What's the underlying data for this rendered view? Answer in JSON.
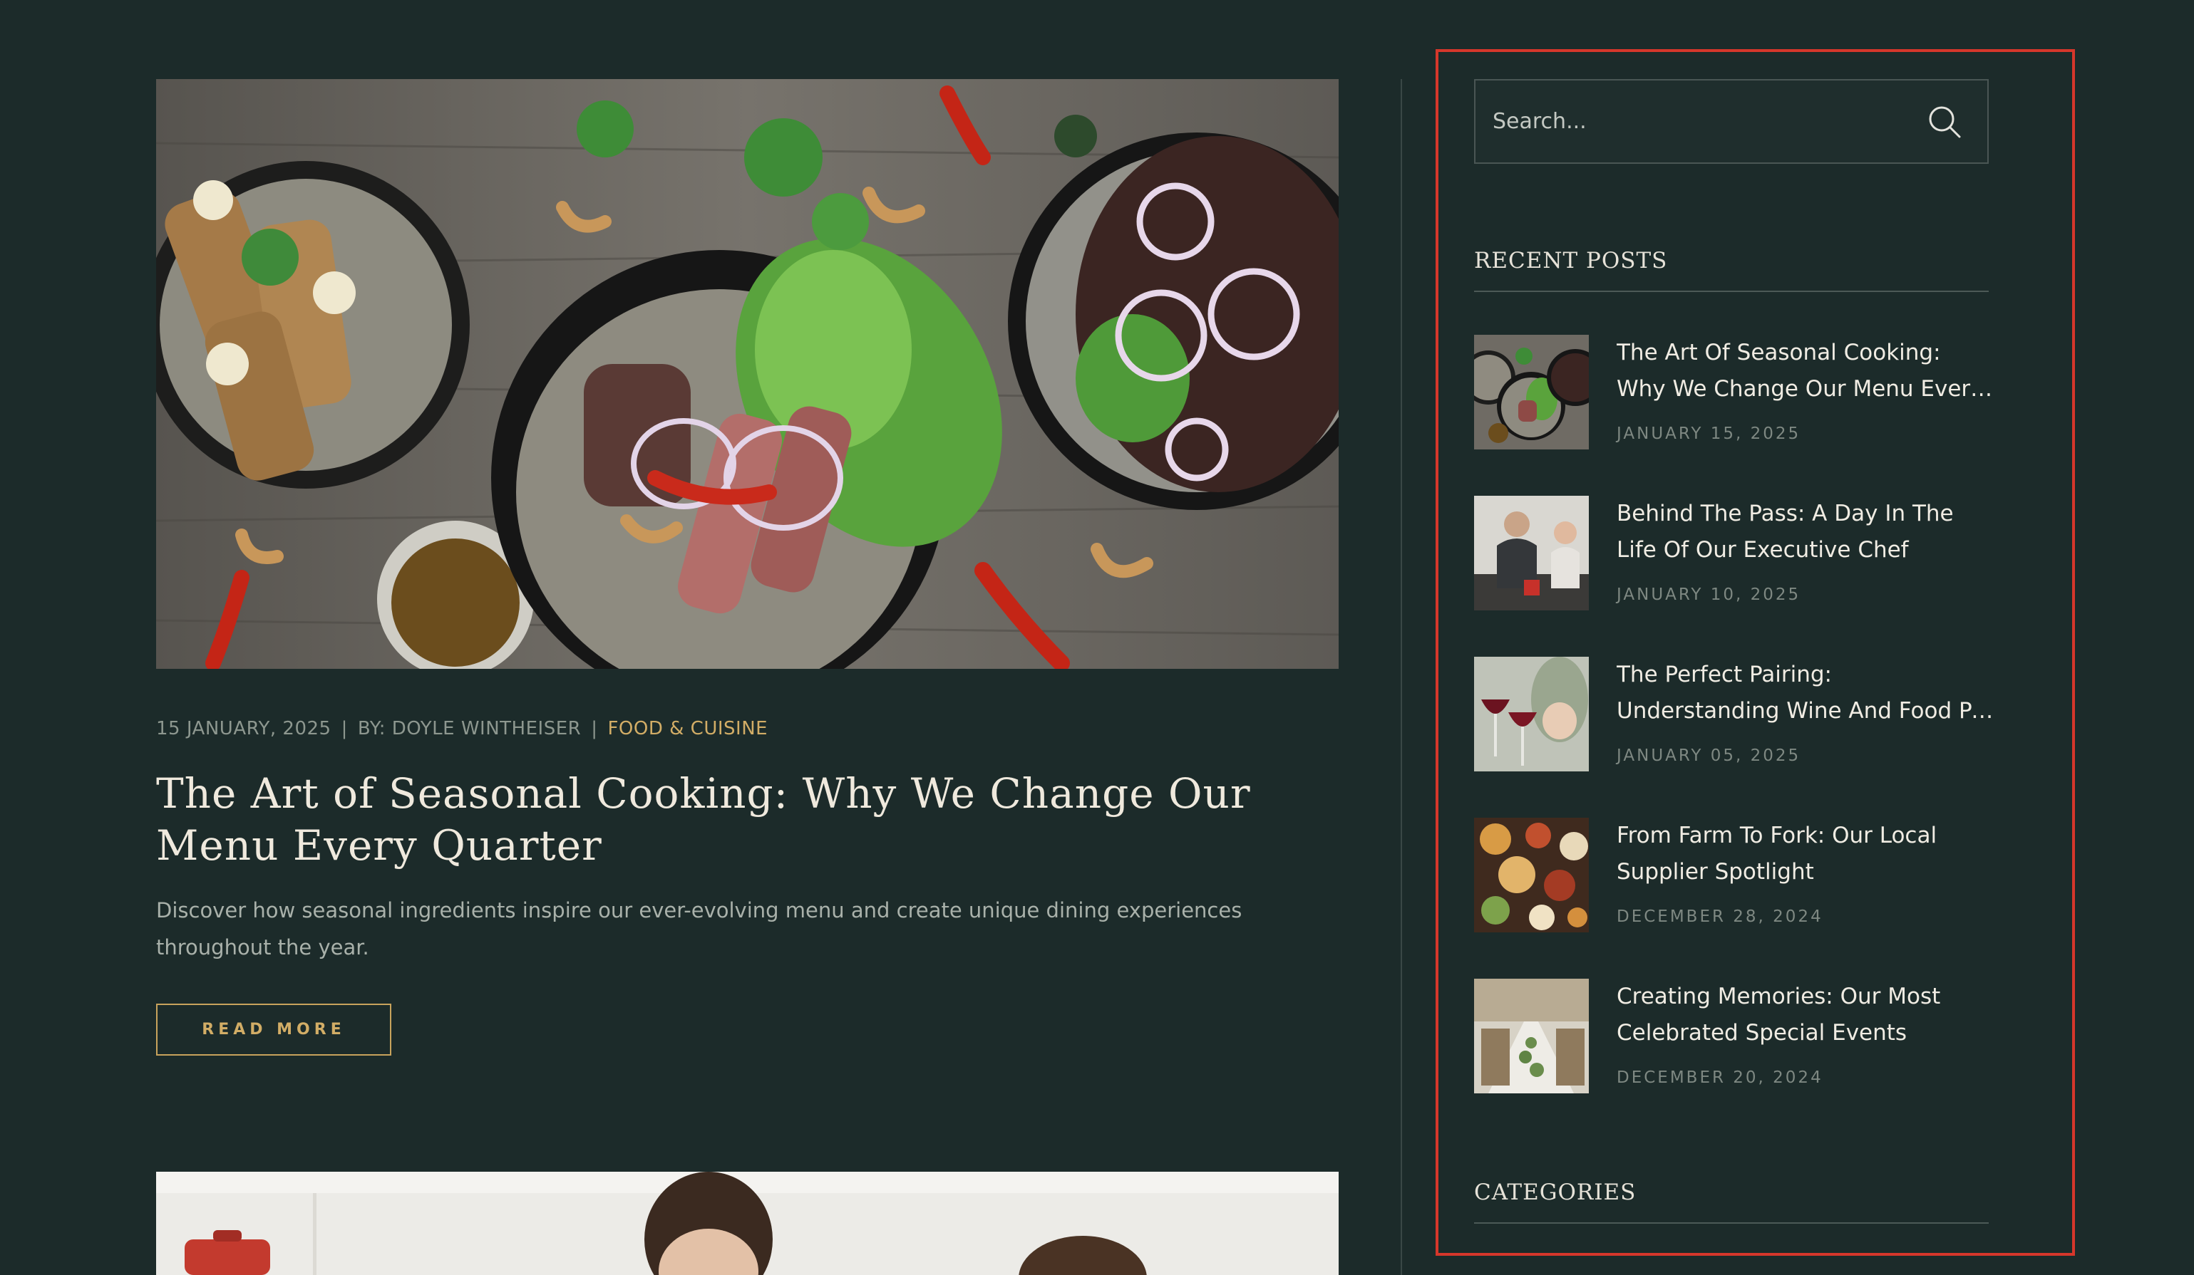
{
  "post": {
    "date": "15 JANUARY, 2025",
    "separator": "|",
    "author": "BY: DOYLE WINTHEISER",
    "category": "FOOD & CUISINE",
    "title": "The Art of Seasonal Cooking: Why We Change Our Menu Every Quarter",
    "excerpt": "Discover how seasonal ingredients inspire our ever-evolving menu and create unique dining experiences throughout the year.",
    "read_more_label": "READ MORE"
  },
  "sidebar": {
    "search": {
      "placeholder": "Search..."
    },
    "recent_posts_title": "RECENT POSTS",
    "recent_posts": [
      {
        "title_line1": "The Art Of Seasonal Cooking:",
        "title_line2": "Why We Change Our Menu Every Quarter",
        "date": "JANUARY 15, 2025"
      },
      {
        "title_line1": "Behind The Pass: A Day In The",
        "title_line2": "Life Of Our Executive Chef",
        "date": "JANUARY 10, 2025"
      },
      {
        "title_line1": "The Perfect Pairing:",
        "title_line2": "Understanding Wine And Food Pairings",
        "date": "JANUARY 05, 2025"
      },
      {
        "title_line1": "From Farm To Fork: Our Local",
        "title_line2": "Supplier Spotlight",
        "date": "DECEMBER 28, 2024"
      },
      {
        "title_line1": "Creating Memories: Our Most",
        "title_line2": "Celebrated Special Events",
        "date": "DECEMBER 20, 2024"
      }
    ],
    "categories_title": "CATEGORIES"
  },
  "colors": {
    "background": "#1c2b2a",
    "accent_gold": "#d2ad66",
    "highlight_frame": "#d6372b"
  },
  "icons": {
    "search": "search-icon"
  }
}
